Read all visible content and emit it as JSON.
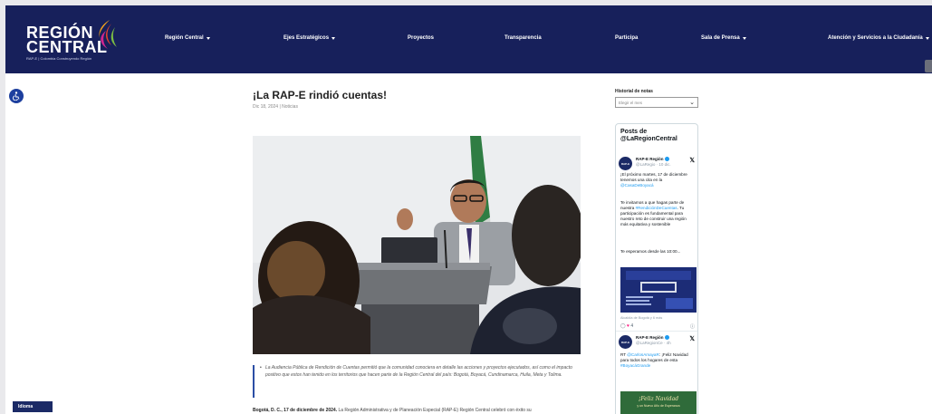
{
  "header": {
    "logo": {
      "line1": "REGIÓN",
      "line2": "CENTRAL",
      "tagline": "RAP-E | Colombia Construyendo Región"
    },
    "nav": [
      {
        "label": "Región Central",
        "dropdown": true
      },
      {
        "label": "Ejes Estratégicos",
        "dropdown": true
      },
      {
        "label": "Proyectos",
        "dropdown": false
      },
      {
        "label": "Transparencia",
        "dropdown": false
      },
      {
        "label": "Participa",
        "dropdown": false
      },
      {
        "label": "Sala de Prensa",
        "dropdown": true
      },
      {
        "label": "Atención y Servicios a la Ciudadanía",
        "dropdown": true
      }
    ]
  },
  "article": {
    "title": "¡La RAP-E rindió cuentas!",
    "date": "Dic 18, 2024",
    "category": "Noticias",
    "quote": "La Audiencia Pública de Rendición de Cuentas permitió que la comunidad conociera en detalle las acciones y proyectos ejecutados, así como el impacto positivo que estos han tenido en los territorios que hacen parte de la Región Central del país: Bogotá, Boyacá, Cundinamarca, Huila, Meta y Tolima.",
    "body_lead": "Bogotá, D. C., 17 de diciembre de 2024.",
    "body_rest": "La Región Administrativa y de Planeación Especial (RAP-E) Región Central celebró con éxito su"
  },
  "sidebar": {
    "history_label": "Historial de notas",
    "history_placeholder": "Elegir el mes",
    "twitter_title": "Posts de @LaRegionCentral",
    "posts": [
      {
        "avatar": "RAP-E",
        "name": "RAP-E Región",
        "handle": "@LaRegio · 10 dic.",
        "text1": "¡El próximo martes, 17 de diciembre tenemos una cita en la",
        "link1": "@CasaDeBoyacá",
        "text2": "Te invitamos a que hagas parte de nuestra",
        "link2": "#RendiciónDeCuentas",
        "text3": ". Tu participación es fundamental para nuestro reto de construir una región más equitativa y sostenible",
        "text4": "Te esperamos desde las 10:00...",
        "caption": "Alcaldía de Bogotá y 6 más",
        "likes": "4"
      },
      {
        "avatar": "RAP-E",
        "name": "RAP-E Región",
        "handle": "@LaRegionCe · 4h",
        "text1": "RT",
        "link1": "@CarlosAmayaR",
        "text2": ": ¡Feliz Navidad para todos los hogares de esta",
        "link2": "#BoyacáGrande",
        "media_text": "¡Feliz Navidad",
        "media_sub": "y un Nuevo Año de Esperanza"
      }
    ]
  },
  "language_label": "Idioma",
  "colors": {
    "header_bg": "#17205b",
    "link": "#1d9bf0",
    "accent": "#2b4ea5"
  }
}
